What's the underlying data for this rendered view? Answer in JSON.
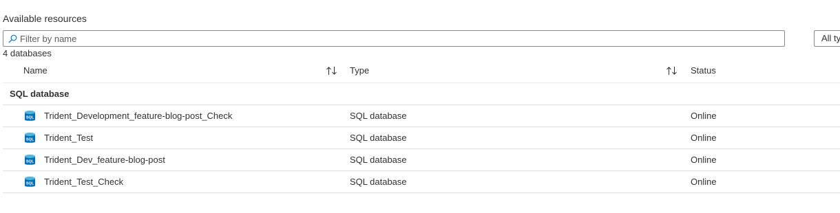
{
  "section_title": "Available resources",
  "filter": {
    "placeholder": "Filter by name",
    "value": "",
    "search_icon": "search-icon"
  },
  "type_filter": {
    "label": "All types"
  },
  "count_text": "4 databases",
  "columns": {
    "name": "Name",
    "type": "Type",
    "status": "Status",
    "sort_icon": "sort-arrows-icon"
  },
  "group": {
    "label": "SQL database"
  },
  "rows": [
    {
      "name": "Trident_Development_feature-blog-post_Check",
      "type": "SQL database",
      "status": "Online",
      "icon": "sql-database-icon"
    },
    {
      "name": "Trident_Test",
      "type": "SQL database",
      "status": "Online",
      "icon": "sql-database-icon"
    },
    {
      "name": "Trident_Dev_feature-blog-post",
      "type": "SQL database",
      "status": "Online",
      "icon": "sql-database-icon"
    },
    {
      "name": "Trident_Test_Check",
      "type": "SQL database",
      "status": "Online",
      "icon": "sql-database-icon"
    }
  ],
  "colors": {
    "accent": "#0078d4",
    "border": "#8a8886",
    "divider": "#e1dfdd",
    "text": "#323130"
  }
}
